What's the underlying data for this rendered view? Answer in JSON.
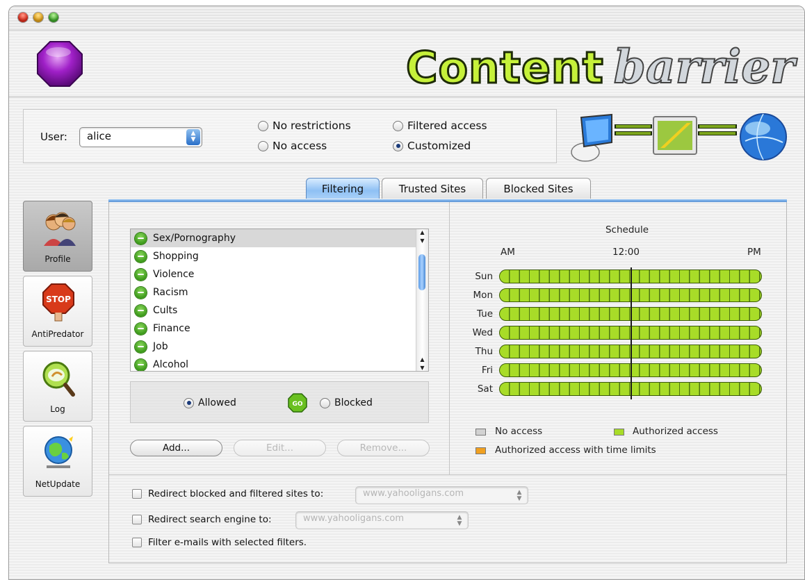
{
  "app": {
    "brand_word1": "Content",
    "brand_word2": "barrier"
  },
  "user": {
    "label": "User:",
    "selected": "alice"
  },
  "access_modes": [
    {
      "label": "No restrictions",
      "selected": false
    },
    {
      "label": "No access",
      "selected": false
    },
    {
      "label": "Filtered access",
      "selected": false
    },
    {
      "label": "Customized",
      "selected": true
    }
  ],
  "tabs": [
    {
      "label": "Filtering",
      "active": true
    },
    {
      "label": "Trusted Sites",
      "active": false
    },
    {
      "label": "Blocked Sites",
      "active": false
    }
  ],
  "sidebar": [
    {
      "label": "Profile",
      "icon": "profile-icon",
      "active": true
    },
    {
      "label": "AntiPredator",
      "icon": "stop-hand-icon",
      "active": false
    },
    {
      "label": "Log",
      "icon": "log-magnifier-icon",
      "active": false
    },
    {
      "label": "NetUpdate",
      "icon": "globe-icon",
      "active": false
    }
  ],
  "categories": [
    {
      "label": "Sex/Pornography",
      "selected": true
    },
    {
      "label": "Shopping"
    },
    {
      "label": "Violence"
    },
    {
      "label": "Racism"
    },
    {
      "label": "Cults"
    },
    {
      "label": "Finance"
    },
    {
      "label": "Job"
    },
    {
      "label": "Alcohol"
    }
  ],
  "allow_block": {
    "allowed_label": "Allowed",
    "blocked_label": "Blocked",
    "go_label": "GO",
    "selected": "Allowed"
  },
  "buttons": {
    "add": "Add...",
    "edit": "Edit...",
    "remove": "Remove..."
  },
  "schedule": {
    "title": "Schedule",
    "am": "AM",
    "noon": "12:00",
    "pm": "PM",
    "days": [
      "Sun",
      "Mon",
      "Tue",
      "Wed",
      "Thu",
      "Fri",
      "Sat"
    ]
  },
  "legend": {
    "no_access": "No access",
    "authorized": "Authorized access",
    "time_limits": "Authorized access with time limits",
    "colors": {
      "no_access": "#d2d2d2",
      "authorized": "#a8dc28",
      "time_limits": "#f0a020"
    }
  },
  "options": {
    "redirect_sites_label": "Redirect blocked and filtered sites to:",
    "redirect_sites_value": "www.yahooligans.com",
    "redirect_search_label": "Redirect search engine to:",
    "redirect_search_value": "www.yahooligans.com",
    "filter_email_label": "Filter e-mails with selected filters."
  }
}
